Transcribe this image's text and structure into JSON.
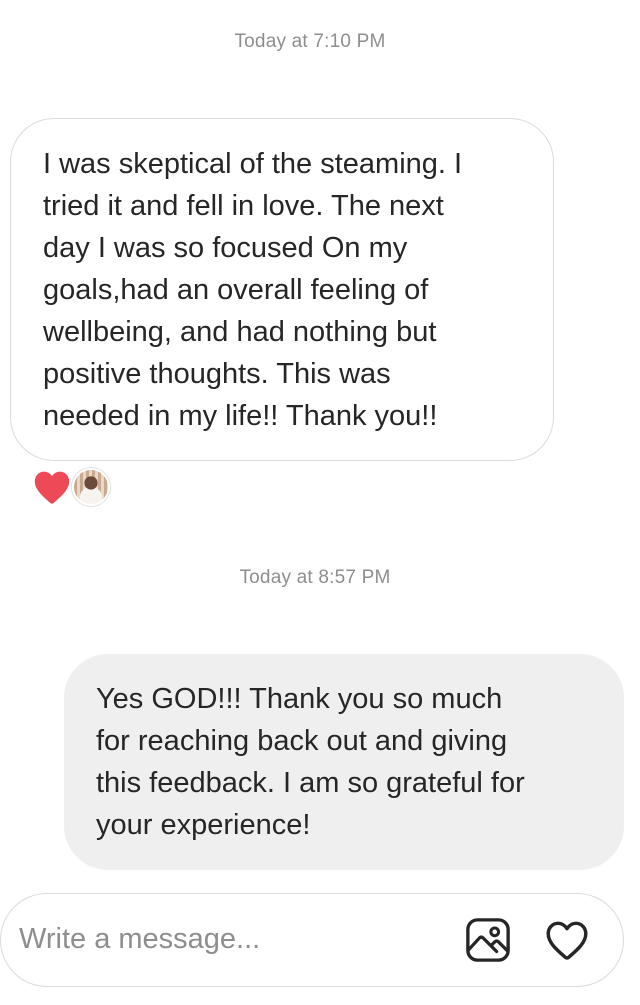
{
  "thread": {
    "messages": [
      {
        "timestamp": "Today at 7:10 PM",
        "direction": "received",
        "lines": [
          "I was skeptical of the steaming. I",
          "tried it and fell in love. The next",
          "day I was so focused On my",
          "goals,had an overall feeling of",
          "wellbeing, and had nothing but",
          "positive thoughts. This was",
          "needed in my life!! Thank you!!"
        ],
        "reactions": [
          "heart-icon"
        ]
      },
      {
        "timestamp": "Today at 8:57 PM",
        "direction": "sent",
        "lines": [
          "Yes GOD!!! Thank you so much",
          "for reaching back out and giving",
          "this feedback. I am so grateful for",
          "your experience!"
        ]
      }
    ]
  },
  "composer": {
    "placeholder": "Write a message...",
    "value": "",
    "image_icon": "image-icon",
    "like_icon": "heart-outline-icon"
  },
  "colors": {
    "heart_reaction": "#ed4956",
    "sent_bubble": "#efefef",
    "received_border": "#dbdbdb",
    "timestamp_text": "#8e8e8e"
  }
}
